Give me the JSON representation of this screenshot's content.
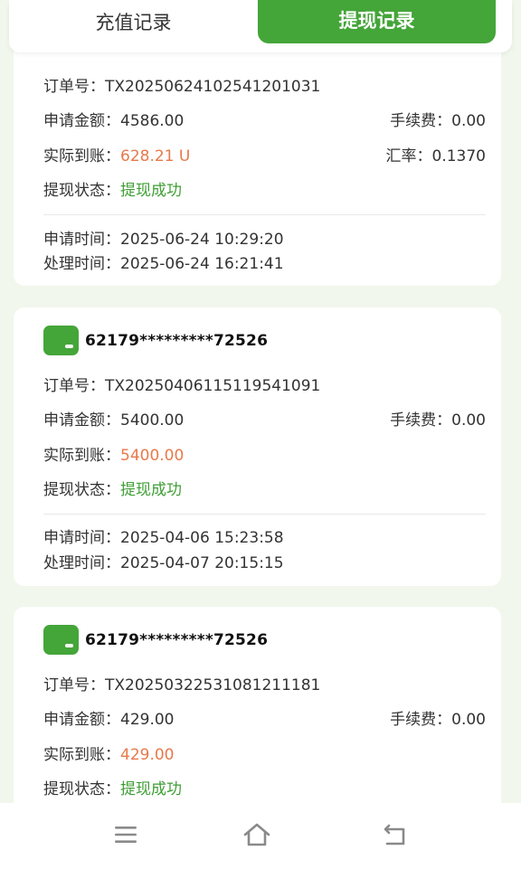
{
  "tabs": {
    "recharge": "充值记录",
    "withdraw": "提现记录"
  },
  "labels": {
    "order_no": "订单号：",
    "amount": "申请金额：",
    "fee": "手续费：",
    "actual": "实际到账：",
    "rate": "汇率：",
    "status": "提现状态：",
    "apply_time": "申请时间：",
    "process_time": "处理时间："
  },
  "records": [
    {
      "order_no": "TX20250624102541201031",
      "amount": "4586.00",
      "fee": "0.00",
      "actual": "628.21 U",
      "rate": "0.1370",
      "status": "提现成功",
      "apply_time": "2025-06-24 10:29:20",
      "process_time": "2025-06-24 16:21:41"
    },
    {
      "card_number": "62179*********72526",
      "order_no": "TX20250406115119541091",
      "amount": "5400.00",
      "fee": "0.00",
      "actual": "5400.00",
      "status": "提现成功",
      "apply_time": "2025-04-06 15:23:58",
      "process_time": "2025-04-07 20:15:15"
    },
    {
      "card_number": "62179*********72526",
      "order_no": "TX20250322531081211181",
      "amount": "429.00",
      "fee": "0.00",
      "actual": "429.00",
      "status": "提现成功"
    }
  ],
  "nav": {
    "menu_icon": "menu-icon",
    "home_icon": "home-icon",
    "back_icon": "back-icon"
  },
  "colors": {
    "brand_green": "#44a539",
    "amount_orange": "#e8794a",
    "status_green": "#3f9e35",
    "background": "#f1f7ec"
  }
}
